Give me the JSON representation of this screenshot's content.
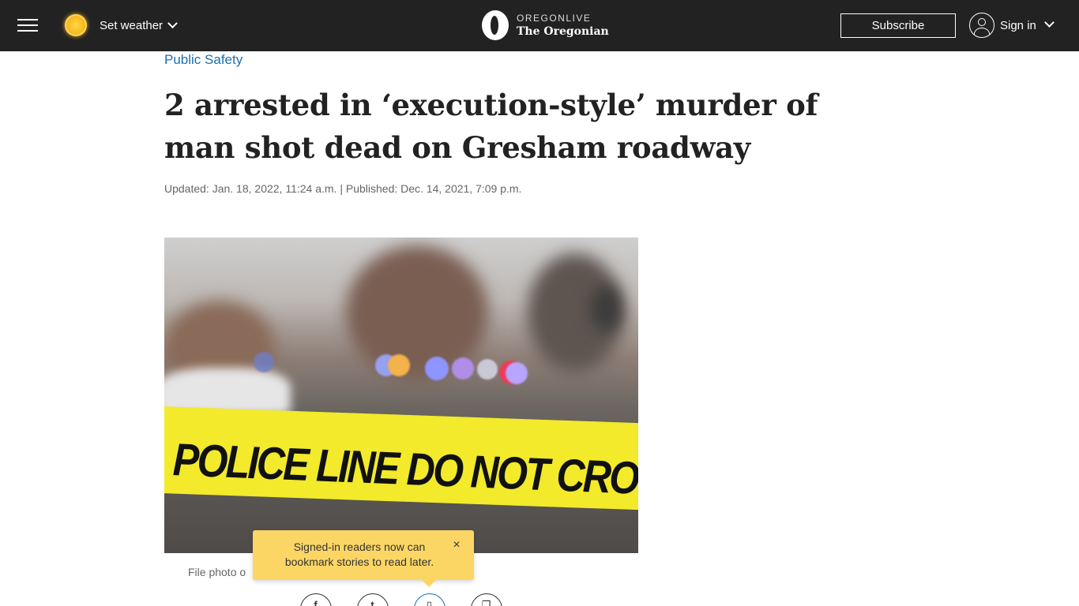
{
  "header": {
    "weather_label": "Set weather",
    "logo_top": "OREGONLIVE",
    "logo_bottom": "The Oregonian",
    "subscribe_label": "Subscribe",
    "signin_label": "Sign in"
  },
  "article": {
    "section": "Public Safety",
    "headline": "2 arrested in ‘execution-style’ murder of man shot dead on Gresham roadway",
    "dateline": "Updated: Jan. 18, 2022, 11:24 a.m. | Published: Dec. 14, 2021, 7:09 p.m.",
    "photo_tape_text": "POLICE LINE DO NOT CROSS",
    "caption": "File photo o"
  },
  "tooltip": {
    "text": "Signed-in readers now can bookmark stories to read later.",
    "close_glyph": "×"
  },
  "share": {
    "facebook_glyph": "f",
    "twitter_glyph": "t",
    "bookmark_glyph": "▯",
    "copy_glyph": "❐"
  },
  "colors": {
    "topbar": "#222222",
    "section_link": "#1a6fb0",
    "tooltip_bg": "#fcd665",
    "tape": "#f2ea2a"
  }
}
